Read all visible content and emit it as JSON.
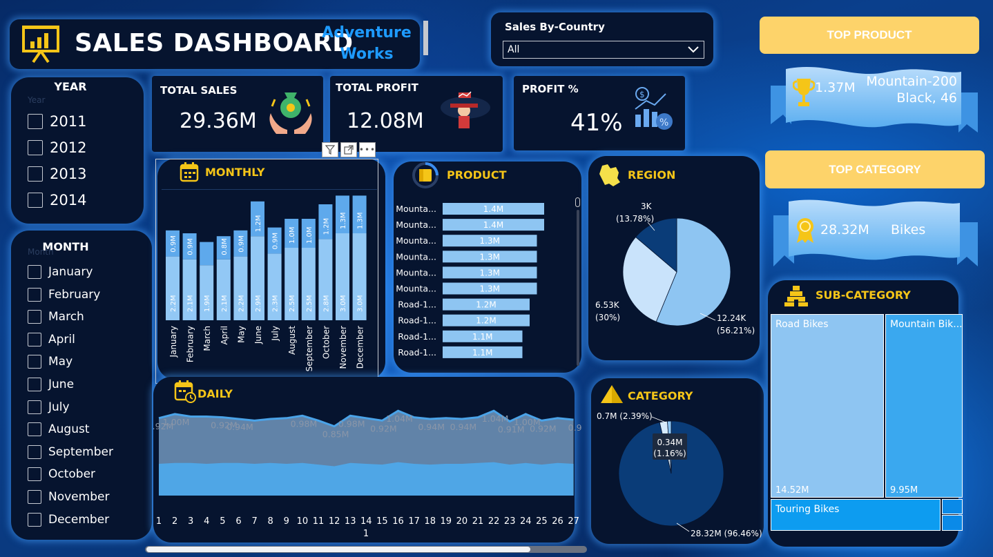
{
  "header": {
    "title": "SALES DASHBOARD",
    "brand_line1": "Adventure",
    "brand_line2": "Works"
  },
  "country_filter": {
    "label": "Sales By-Country",
    "value": "All"
  },
  "year_slicer": {
    "title": "YEAR",
    "ghost_label": "Year",
    "items": [
      "2011",
      "2012",
      "2013",
      "2014"
    ]
  },
  "month_slicer": {
    "title": "MONTH",
    "ghost_label": "Month",
    "items": [
      "January",
      "February",
      "March",
      "April",
      "May",
      "June",
      "July",
      "August",
      "September",
      "October",
      "November",
      "December"
    ]
  },
  "kpis": {
    "total_sales": {
      "label": "TOTAL SALES",
      "value": "29.36M"
    },
    "total_profit": {
      "label": "TOTAL PROFIT",
      "value": "12.08M"
    },
    "profit_pct": {
      "label": "PROFIT %",
      "value": "41%"
    }
  },
  "top_product": {
    "button": "TOP PRODUCT",
    "value": "1.37M",
    "name_line1": "Mountain-200",
    "name_line2": "Black, 46"
  },
  "top_category": {
    "button": "TOP CATEGORY",
    "value": "28.32M",
    "name": "Bikes"
  },
  "monthly": {
    "title": "MONTHLY"
  },
  "product": {
    "title": "PRODUCT"
  },
  "region": {
    "title": "REGION"
  },
  "category": {
    "title": "CATEGORY"
  },
  "daily": {
    "title": "DAILY",
    "axis_sub": "1"
  },
  "subcategory": {
    "title": "SUB-CATEGORY"
  },
  "colors": {
    "panel_bg": "#06142f",
    "title_yellow": "#f5c518",
    "bar_dark": "#5ea9ec",
    "bar_light": "#92c8f5",
    "accent_blue": "#1e90ff"
  },
  "chart_data": [
    {
      "type": "bar",
      "title": "MONTHLY",
      "categories": [
        "January",
        "February",
        "March",
        "April",
        "May",
        "June",
        "July",
        "August",
        "September",
        "October",
        "November",
        "December"
      ],
      "series": [
        {
          "values": [
            2.2,
            2.1,
            1.9,
            2.1,
            2.2,
            2.9,
            2.3,
            2.5,
            2.5,
            2.8,
            3.0,
            3.0
          ],
          "labels": [
            "2.2M",
            "2.1M",
            "1.9M",
            "2.1M",
            "2.2M",
            "2.9M",
            "2.3M",
            "2.5M",
            "2.5M",
            "2.8M",
            "3.0M",
            "3.0M"
          ]
        },
        {
          "values": [
            0.9,
            0.9,
            0.8,
            0.8,
            0.9,
            1.2,
            0.9,
            1.0,
            1.0,
            1.2,
            1.3,
            1.3
          ],
          "labels": [
            "0.9M",
            "0.9M",
            "",
            "0.8M",
            "0.9M",
            "1.2M",
            "0.9M",
            "1.0M",
            "1.0M",
            "1.2M",
            "1.3M",
            "1.3M"
          ]
        }
      ],
      "stacked": true
    },
    {
      "type": "bar",
      "title": "PRODUCT",
      "orientation": "horizontal",
      "categories": [
        "Mounta...",
        "Mounta...",
        "Mounta...",
        "Mounta...",
        "Mounta...",
        "Mounta...",
        "Road-1...",
        "Road-1...",
        "Road-1...",
        "Road-1..."
      ],
      "values": [
        1.4,
        1.4,
        1.3,
        1.3,
        1.3,
        1.3,
        1.2,
        1.2,
        1.1,
        1.1
      ],
      "labels": [
        "1.4M",
        "1.4M",
        "1.3M",
        "1.3M",
        "1.3M",
        "1.3M",
        "1.2M",
        "1.2M",
        "1.1M",
        "1.1M"
      ]
    },
    {
      "type": "pie",
      "title": "REGION",
      "slices": [
        {
          "value": 12.24,
          "label": "12.24K",
          "pct": "(56.21%)",
          "color": "#8ec5f2"
        },
        {
          "value": 6.53,
          "label": "6.53K",
          "pct": "(30%)",
          "color": "#c9e3fb"
        },
        {
          "value": 3,
          "label": "3K",
          "pct": "(13.78%)",
          "color": "#0a3c78"
        }
      ]
    },
    {
      "type": "pie",
      "title": "CATEGORY",
      "slices": [
        {
          "value": 28.32,
          "label": "28.32M (96.46%)",
          "color": "#0a3c78"
        },
        {
          "value": 0.7,
          "label": "0.7M (2.39%)",
          "color": "#d7ebfd"
        },
        {
          "value": 0.34,
          "label": "0.34M",
          "pct": "(1.16%)",
          "color": "#8ec5f2"
        }
      ]
    },
    {
      "type": "area",
      "title": "DAILY",
      "x": [
        1,
        2,
        3,
        4,
        5,
        6,
        7,
        8,
        9,
        10,
        11,
        12,
        13,
        14,
        15,
        16,
        17,
        18,
        19,
        20,
        21,
        22,
        23,
        24,
        25,
        26,
        27
      ],
      "series": [
        {
          "values": [
            0.95,
            1.0,
            0.97,
            0.97,
            0.96,
            0.94,
            0.92,
            0.94,
            0.95,
            0.98,
            0.92,
            0.85,
            0.98,
            0.95,
            0.92,
            1.04,
            0.96,
            0.94,
            0.95,
            0.94,
            0.96,
            1.04,
            0.91,
            1.0,
            0.92,
            0.95,
            0.93
          ]
        },
        {
          "values": [
            0.39,
            0.4,
            0.4,
            0.39,
            0.4,
            0.4,
            0.39,
            0.4,
            0.39,
            0.4,
            0.38,
            0.36,
            0.4,
            0.39,
            0.38,
            0.41,
            0.39,
            0.38,
            0.39,
            0.39,
            0.4,
            0.41,
            0.38,
            0.4,
            0.38,
            0.4,
            0.39
          ]
        }
      ],
      "point_labels": [
        {
          "x": 2,
          "text": "1.00M"
        },
        {
          "x": 1,
          "text": "0.92M"
        },
        {
          "x": 5,
          "text": "0.92M"
        },
        {
          "x": 6,
          "text": "0.94M"
        },
        {
          "x": 10,
          "text": "0.98M"
        },
        {
          "x": 12,
          "text": "0.85M"
        },
        {
          "x": 13,
          "text": "0.98M"
        },
        {
          "x": 15,
          "text": "0.92M"
        },
        {
          "x": 16,
          "text": "1.04M"
        },
        {
          "x": 18,
          "text": "0.94M"
        },
        {
          "x": 20,
          "text": "0.94M"
        },
        {
          "x": 22,
          "text": "1.04M"
        },
        {
          "x": 23,
          "text": "0.91M"
        },
        {
          "x": 24,
          "text": "1.00M"
        },
        {
          "x": 25,
          "text": "0.92M"
        },
        {
          "x": 27,
          "text": "0.9"
        }
      ]
    },
    {
      "type": "treemap",
      "title": "SUB-CATEGORY",
      "items": [
        {
          "name": "Road Bikes",
          "value": 14.52,
          "label": "14.52M"
        },
        {
          "name": "Mountain Bik...",
          "value": 9.95,
          "label": "9.95M"
        },
        {
          "name": "Touring Bikes",
          "value": 3.85,
          "label": ""
        }
      ]
    }
  ]
}
